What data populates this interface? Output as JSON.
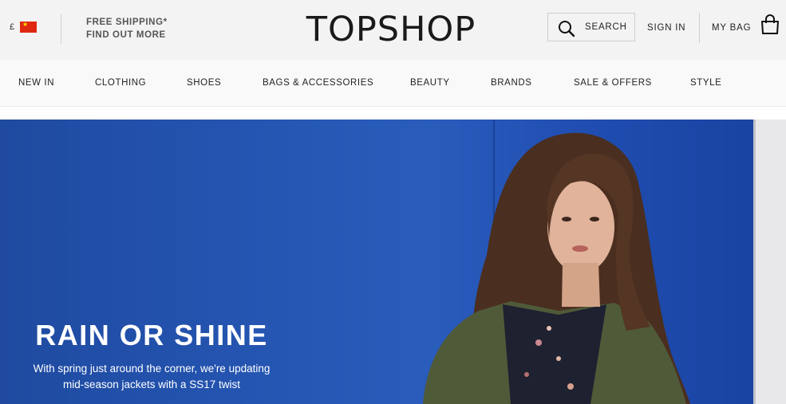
{
  "header": {
    "currency": "£",
    "promo_line1": "FREE SHIPPING*",
    "promo_line2": "FIND OUT MORE",
    "logo": "TOPSHOP",
    "search_label": "SEARCH",
    "signin_label": "SIGN IN",
    "bag_label": "MY BAG"
  },
  "nav": {
    "items": [
      {
        "label": "NEW IN"
      },
      {
        "label": "CLOTHING"
      },
      {
        "label": "SHOES"
      },
      {
        "label": "BAGS & ACCESSORIES"
      },
      {
        "label": "BEAUTY"
      },
      {
        "label": "BRANDS"
      },
      {
        "label": "SALE & OFFERS"
      },
      {
        "label": "STYLE"
      }
    ]
  },
  "hero": {
    "title": "RAIN OR SHINE",
    "line1": "With spring just around the corner, we're updating",
    "line2": "mid-season jackets with a SS17 twist"
  },
  "colors": {
    "hero_blue": "#2556b3",
    "flag_red": "#de2910"
  },
  "icons": [
    "china-flag-icon",
    "search-icon",
    "shopping-bag-icon"
  ]
}
